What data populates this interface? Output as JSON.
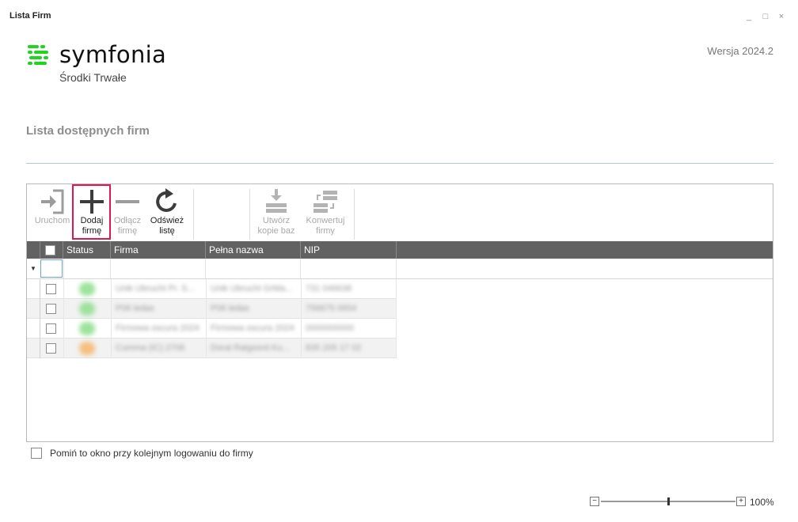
{
  "window": {
    "title": "Lista Firm",
    "minimize": "_",
    "maximize": "□",
    "close": "×"
  },
  "brand": {
    "name": "symfonia",
    "product": "Środki Trwałe",
    "logo_color": "#1fd51f"
  },
  "version": "Wersja 2024.2",
  "section_title": "Lista dostępnych firm",
  "toolbar": {
    "buttons": [
      {
        "label": "Uruchom",
        "icon": "enter-icon",
        "enabled": false
      },
      {
        "label": "Dodaj\nfirmę",
        "icon": "plus-icon",
        "enabled": true,
        "highlighted": true
      },
      {
        "label": "Odłącz\nfirmę",
        "icon": "minus-icon",
        "enabled": false
      },
      {
        "label": "Odśwież\nlistę",
        "icon": "refresh-icon",
        "enabled": true
      },
      {
        "label": "Utwórz\nkopie baz",
        "icon": "backup-icon",
        "enabled": false
      },
      {
        "label": "Konwertuj\nfirmy",
        "icon": "convert-icon",
        "enabled": false
      }
    ]
  },
  "grid": {
    "columns": [
      "Status",
      "Firma",
      "Pełna nazwa",
      "NIP"
    ],
    "filter_icon": "▼",
    "rows": [
      {
        "status_color": "#9ee29e",
        "firma": "Unik Ubrucht Pr. S...",
        "pelna": "Unik Ubrucht GrMa...",
        "nip": "731 046638"
      },
      {
        "status_color": "#9ee29e",
        "firma": "P06 ledas",
        "pelna": "P06 ledas",
        "nip": "756875 0654"
      },
      {
        "status_color": "#9ee29e",
        "firma": "Firmowa oscura 2024 2",
        "pelna": "Firmowa oscura 2024 2",
        "nip": "0000000000"
      },
      {
        "status_color": "#f6c080",
        "firma": "Cumma (IC) 2706",
        "pelna": "Doral Ralgoord Ku...",
        "nip": "835 205 17 02"
      }
    ]
  },
  "footer": {
    "skip_label": "Pomiń to okno przy kolejnym logowaniu do firmy"
  },
  "zoom": {
    "value": "100%",
    "minus": "−",
    "plus": "+"
  }
}
